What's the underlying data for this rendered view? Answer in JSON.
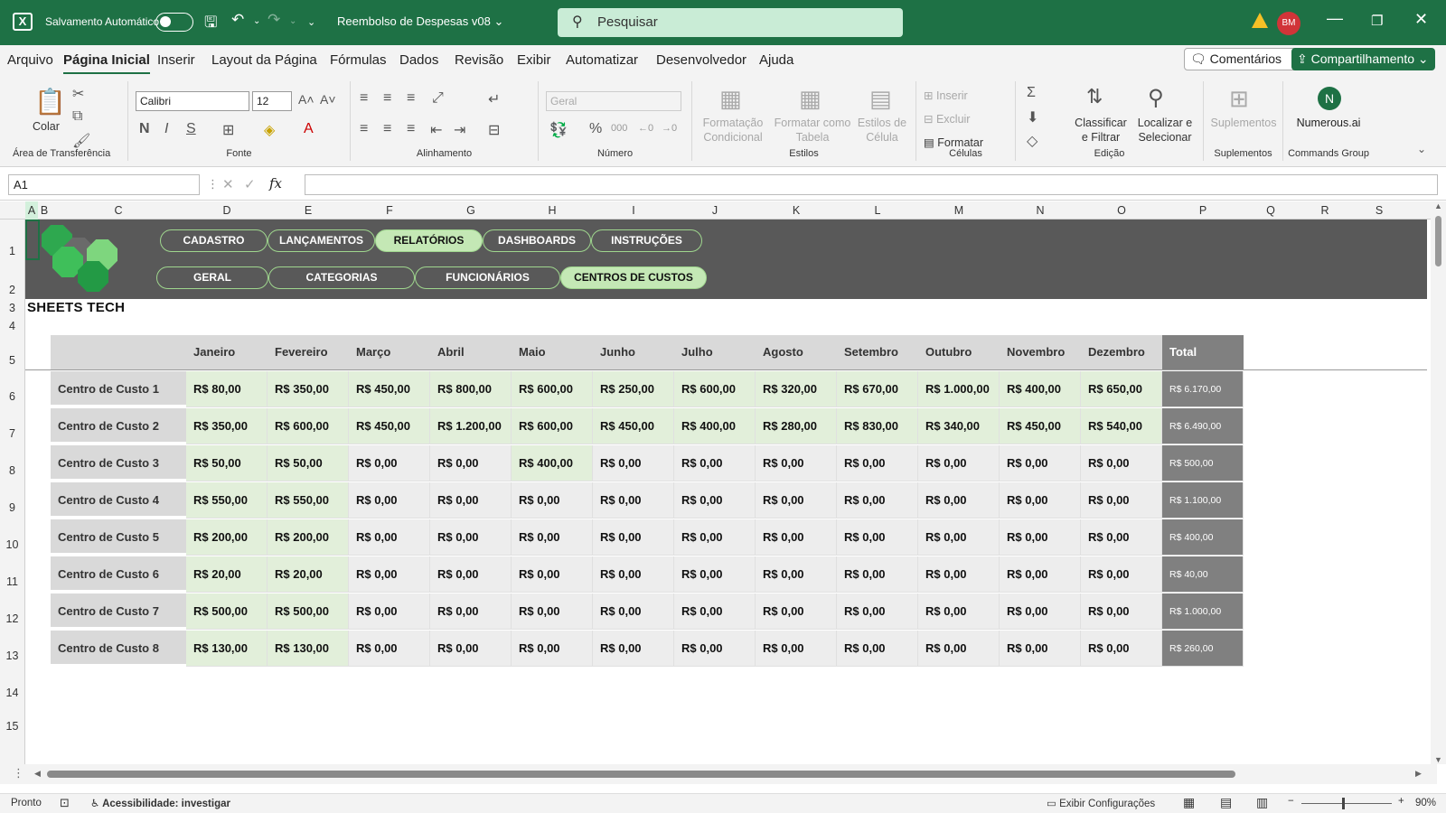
{
  "titlebar": {
    "autosave_label": "Salvamento Automático",
    "doc_title": "Reembolso de Despesas v08",
    "search_placeholder": "Pesquisar",
    "avatar": "BM"
  },
  "menu": {
    "items": [
      "Arquivo",
      "Página Inicial",
      "Inserir",
      "Layout da Página",
      "Fórmulas",
      "Dados",
      "Revisão",
      "Exibir",
      "Automatizar",
      "Desenvolvedor",
      "Ajuda"
    ],
    "active": "Página Inicial",
    "comments": "Comentários",
    "share": "Compartilhamento"
  },
  "ribbon": {
    "paste": "Colar",
    "clipboard_group": "Área de Transferência",
    "font_name": "Calibri",
    "font_size": "12",
    "font_group": "Fonte",
    "align_group": "Alinhamento",
    "number_format": "Geral",
    "number_group": "Número",
    "cond_format": "Formatação Condicional",
    "format_table": "Formatar como Tabela",
    "cell_styles": "Estilos de Célula",
    "styles_group": "Estilos",
    "insert": "Inserir",
    "delete": "Excluir",
    "format": "Formatar",
    "cells_group": "Células",
    "sort_filter": "Classificar e Filtrar",
    "find_select": "Localizar e Selecionar",
    "edit_group": "Edição",
    "addins": "Suplementos",
    "addins_group": "Suplementos",
    "numerous": "Numerous.ai",
    "commands_group": "Commands Group"
  },
  "formula_bar": {
    "name_box": "A1",
    "fx": "fx"
  },
  "columns": [
    "A",
    "B",
    "C",
    "D",
    "E",
    "F",
    "G",
    "H",
    "I",
    "J",
    "K",
    "L",
    "M",
    "N",
    "O",
    "P",
    "Q",
    "R",
    "S"
  ],
  "rows": [
    "1",
    "2",
    "3",
    "4",
    "5",
    "6",
    "7",
    "8",
    "9",
    "10",
    "11",
    "12",
    "13",
    "14",
    "15"
  ],
  "nav": {
    "top": [
      "CADASTRO",
      "LANÇAMENTOS",
      "RELATÓRIOS",
      "DASHBOARDS",
      "INSTRUÇÕES"
    ],
    "top_active": "RELATÓRIOS",
    "sub": [
      "GERAL",
      "CATEGORIAS",
      "FUNCIONÁRIOS",
      "CENTROS DE CUSTOS"
    ],
    "sub_active": "CENTROS DE CUSTOS"
  },
  "brand": "SHEETS TECH",
  "table": {
    "months": [
      "Janeiro",
      "Fevereiro",
      "Março",
      "Abril",
      "Maio",
      "Junho",
      "Julho",
      "Agosto",
      "Setembro",
      "Outubro",
      "Novembro",
      "Dezembro"
    ],
    "total_label": "Total",
    "rows": [
      {
        "label": "Centro de Custo 1",
        "values": [
          "R$ 80,00",
          "R$ 350,00",
          "R$ 450,00",
          "R$ 800,00",
          "R$ 600,00",
          "R$ 250,00",
          "R$ 600,00",
          "R$ 320,00",
          "R$ 670,00",
          "R$ 1.000,00",
          "R$ 400,00",
          "R$ 650,00"
        ],
        "total": "R$ 6.170,00"
      },
      {
        "label": "Centro de Custo 2",
        "values": [
          "R$ 350,00",
          "R$ 600,00",
          "R$ 450,00",
          "R$ 1.200,00",
          "R$ 600,00",
          "R$ 450,00",
          "R$ 400,00",
          "R$ 280,00",
          "R$ 830,00",
          "R$ 340,00",
          "R$ 450,00",
          "R$ 540,00"
        ],
        "total": "R$ 6.490,00"
      },
      {
        "label": "Centro de Custo 3",
        "values": [
          "R$ 50,00",
          "R$ 50,00",
          "R$ 0,00",
          "R$ 0,00",
          "R$ 400,00",
          "R$ 0,00",
          "R$ 0,00",
          "R$ 0,00",
          "R$ 0,00",
          "R$ 0,00",
          "R$ 0,00",
          "R$ 0,00"
        ],
        "total": "R$ 500,00"
      },
      {
        "label": "Centro de Custo 4",
        "values": [
          "R$ 550,00",
          "R$ 550,00",
          "R$ 0,00",
          "R$ 0,00",
          "R$ 0,00",
          "R$ 0,00",
          "R$ 0,00",
          "R$ 0,00",
          "R$ 0,00",
          "R$ 0,00",
          "R$ 0,00",
          "R$ 0,00"
        ],
        "total": "R$ 1.100,00"
      },
      {
        "label": "Centro de Custo 5",
        "values": [
          "R$ 200,00",
          "R$ 200,00",
          "R$ 0,00",
          "R$ 0,00",
          "R$ 0,00",
          "R$ 0,00",
          "R$ 0,00",
          "R$ 0,00",
          "R$ 0,00",
          "R$ 0,00",
          "R$ 0,00",
          "R$ 0,00"
        ],
        "total": "R$ 400,00"
      },
      {
        "label": "Centro de Custo 6",
        "values": [
          "R$ 20,00",
          "R$ 20,00",
          "R$ 0,00",
          "R$ 0,00",
          "R$ 0,00",
          "R$ 0,00",
          "R$ 0,00",
          "R$ 0,00",
          "R$ 0,00",
          "R$ 0,00",
          "R$ 0,00",
          "R$ 0,00"
        ],
        "total": "R$ 40,00"
      },
      {
        "label": "Centro de Custo 7",
        "values": [
          "R$ 500,00",
          "R$ 500,00",
          "R$ 0,00",
          "R$ 0,00",
          "R$ 0,00",
          "R$ 0,00",
          "R$ 0,00",
          "R$ 0,00",
          "R$ 0,00",
          "R$ 0,00",
          "R$ 0,00",
          "R$ 0,00"
        ],
        "total": "R$ 1.000,00"
      },
      {
        "label": "Centro de Custo 8",
        "values": [
          "R$ 130,00",
          "R$ 130,00",
          "R$ 0,00",
          "R$ 0,00",
          "R$ 0,00",
          "R$ 0,00",
          "R$ 0,00",
          "R$ 0,00",
          "R$ 0,00",
          "R$ 0,00",
          "R$ 0,00",
          "R$ 0,00"
        ],
        "total": "R$ 260,00"
      }
    ]
  },
  "status": {
    "ready": "Pronto",
    "accessibility": "Acessibilidade: investigar",
    "display_settings": "Exibir Configurações",
    "zoom": "90%"
  },
  "colors": {
    "accent": "#1e7145",
    "banner": "#595959",
    "pill_active": "#c4e8b5",
    "cell_green": "#e2efda",
    "total_bg": "#808080"
  }
}
